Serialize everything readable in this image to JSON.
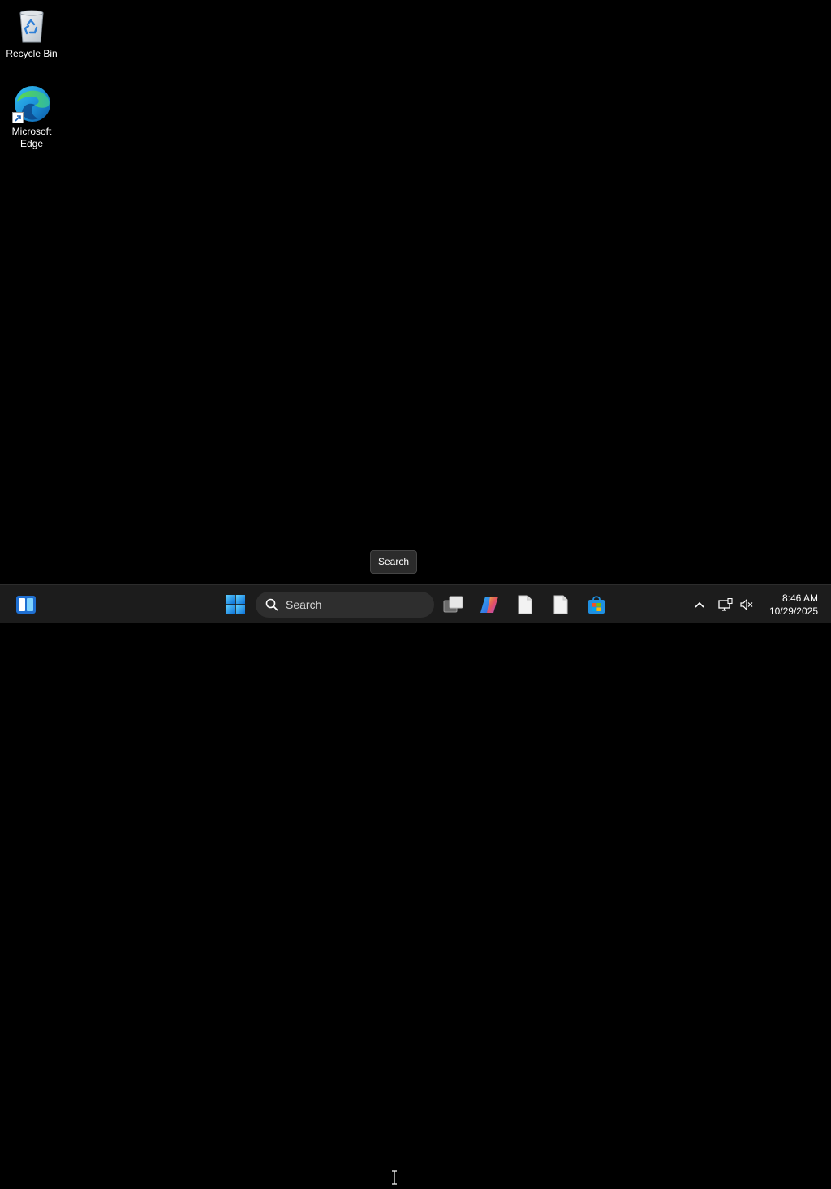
{
  "desktop": {
    "icons": [
      {
        "label": "Recycle Bin",
        "icon": "recycle-bin-icon"
      },
      {
        "label": "Microsoft Edge",
        "icon": "edge-icon"
      }
    ]
  },
  "tooltip": {
    "text": "Search"
  },
  "taskbar": {
    "widgets_icon": "widgets-icon",
    "start_icon": "windows-logo-icon",
    "search": {
      "placeholder": "Search",
      "icon": "search-icon"
    },
    "pinned": [
      {
        "name": "Task View",
        "icon": "task-view-icon"
      },
      {
        "name": "Copilot",
        "icon": "copilot-icon"
      },
      {
        "name": "File",
        "icon": "document-icon"
      },
      {
        "name": "File",
        "icon": "document-icon"
      },
      {
        "name": "Microsoft Store",
        "icon": "store-icon"
      }
    ],
    "tray": {
      "overflow_icon": "chevron-up-icon",
      "network_icon": "network-icon",
      "volume_icon": "volume-muted-icon"
    },
    "clock": {
      "time": "8:46 AM",
      "date": "10/29/2025"
    }
  },
  "colors": {
    "desktop_background": "#000000",
    "taskbar_background": "#1c1c1c",
    "accent": "#0078d4"
  }
}
